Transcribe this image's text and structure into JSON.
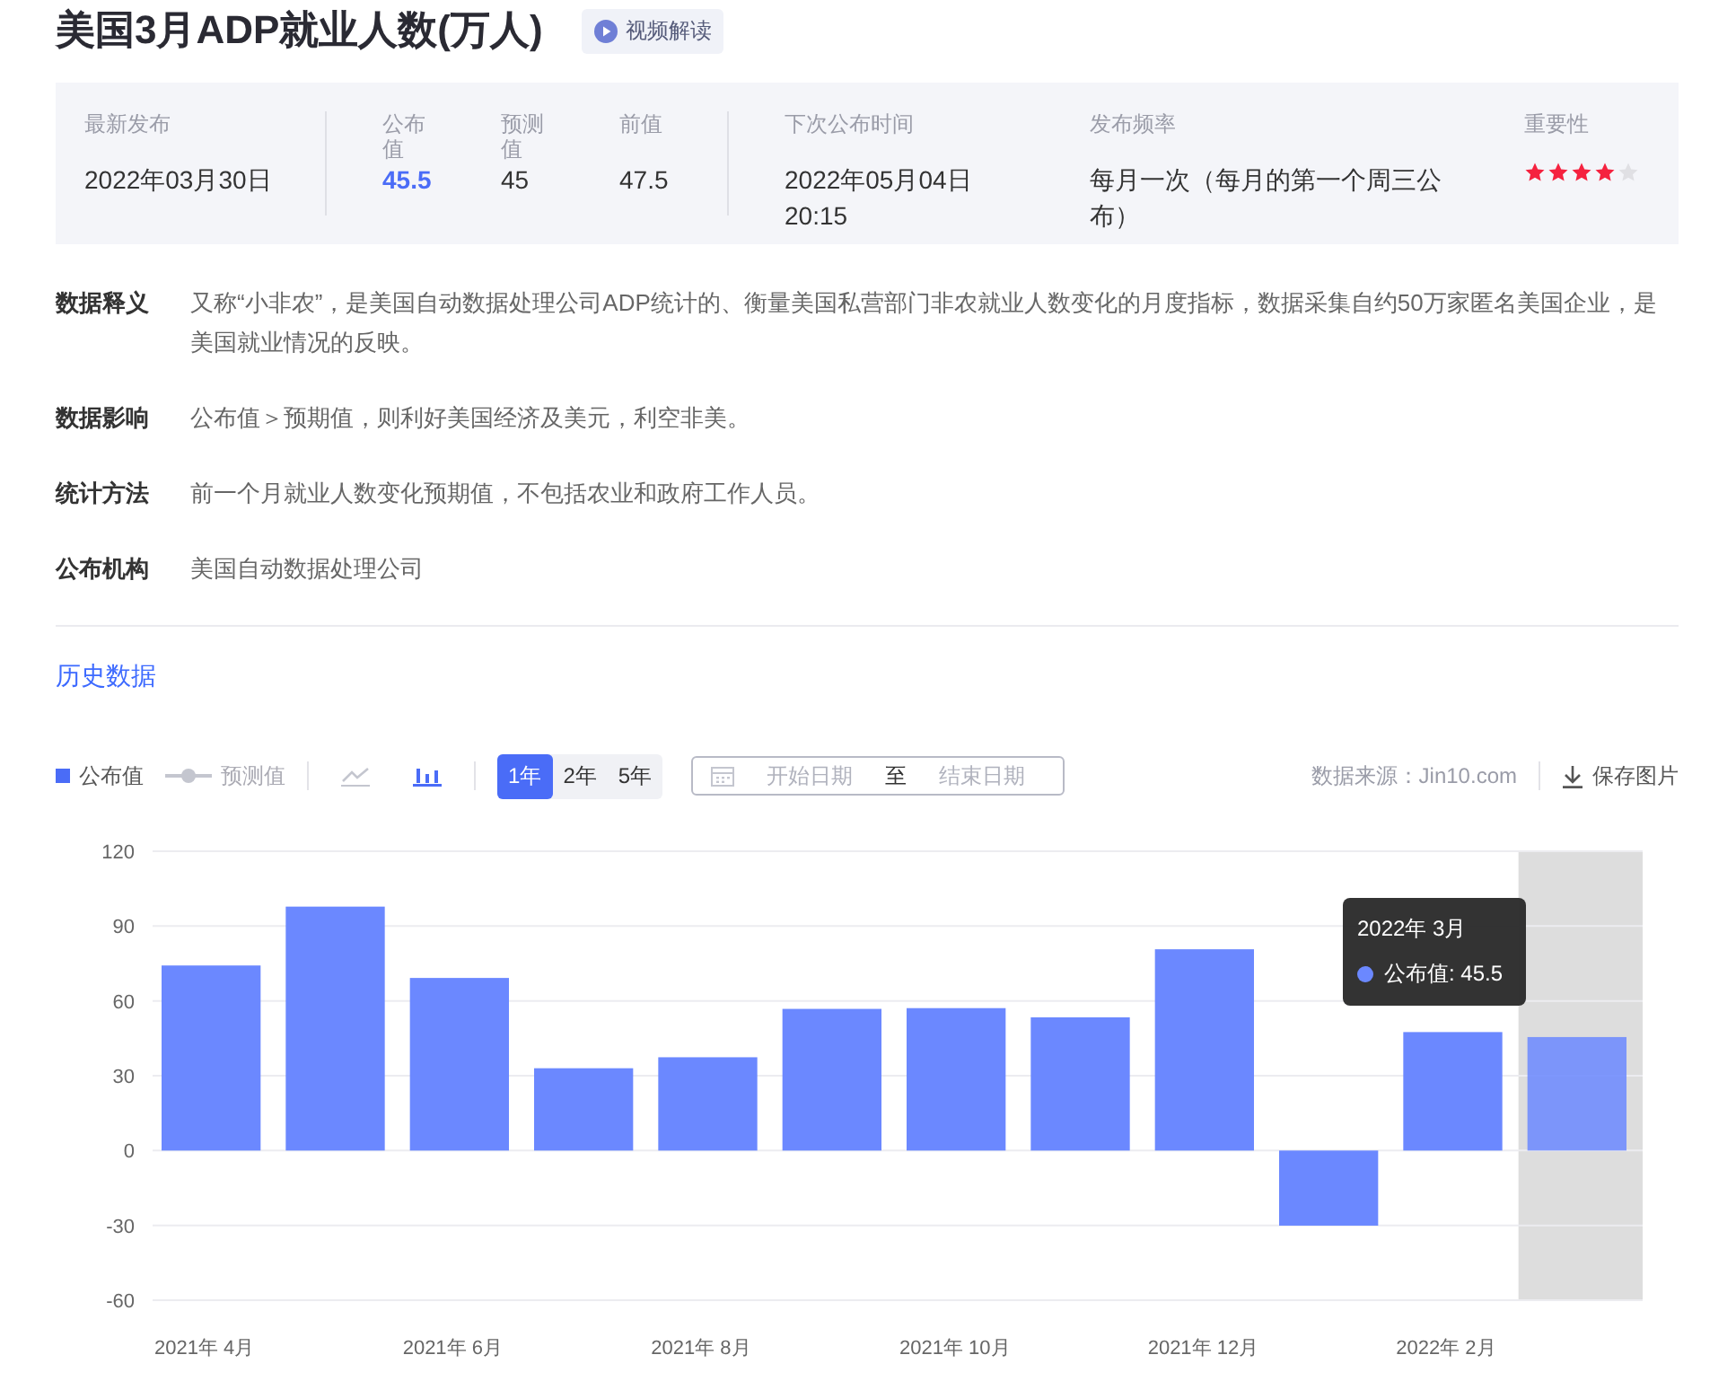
{
  "title": "美国3月ADP就业人数(万人)",
  "video_button": "视频解读",
  "summary": {
    "latest": {
      "label": "最新发布",
      "value": "2022年03月30日"
    },
    "actual": {
      "label": "公布值",
      "value": "45.5"
    },
    "forecast": {
      "label": "预测值",
      "value": "45"
    },
    "previous": {
      "label": "前值",
      "value": "47.5"
    },
    "next": {
      "label": "下次公布时间",
      "value": "2022年05月04日 20:15"
    },
    "frequency": {
      "label": "发布频率",
      "value": "每月一次（每月的第一个周三公布）"
    },
    "importance": {
      "label": "重要性",
      "stars": 4
    }
  },
  "details": [
    {
      "label": "数据释义",
      "text": "又称“小非农”，是美国自动数据处理公司ADP统计的、衡量美国私营部门非农就业人数变化的月度指标，数据采集自约50万家匿名美国企业，是美国就业情况的反映。"
    },
    {
      "label": "数据影响",
      "text": "公布值＞预期值，则利好美国经济及美元，利空非美。"
    },
    {
      "label": "统计方法",
      "text": "前一个月就业人数变化预期值，不包括农业和政府工作人员。"
    },
    {
      "label": "公布机构",
      "text": "美国自动数据处理公司"
    }
  ],
  "history_title": "历史数据",
  "toolbar": {
    "legend": [
      {
        "label": "公布值",
        "kind": "bar",
        "on": true
      },
      {
        "label": "预测值",
        "kind": "line",
        "on": false
      }
    ],
    "chart_types": [
      {
        "kind": "line",
        "selected": false
      },
      {
        "kind": "bar",
        "selected": true
      }
    ],
    "ranges": [
      {
        "label": "1年",
        "selected": true
      },
      {
        "label": "2年",
        "selected": false
      },
      {
        "label": "5年",
        "selected": false
      }
    ],
    "date_range": {
      "start_placeholder": "开始日期",
      "separator": "至",
      "end_placeholder": "结束日期"
    },
    "source": "数据来源：Jin10.com",
    "save": "保存图片"
  },
  "chart": {
    "tooltip": {
      "title": "2022年 3月",
      "separator": ":",
      "value": "45.5"
    },
    "chart_data": {
      "type": "bar",
      "grid": true,
      "categories": [
        "2021年 4月",
        null,
        "2021年 6月",
        null,
        "2021年 8月",
        null,
        "2021年 10月",
        null,
        "2021年 12月",
        null,
        "2022年 2月",
        null
      ],
      "series": [
        {
          "name": "公布值",
          "color": "#6b88ff",
          "values": [
            74.2,
            97.8,
            69.2,
            33,
            37.4,
            56.8,
            57.1,
            53.4,
            80.7,
            -30.1,
            47.5,
            45.5
          ]
        }
      ],
      "ylim": [
        -60,
        120
      ],
      "yticks": [
        -60,
        -30,
        0,
        30,
        60,
        90,
        120
      ]
    }
  }
}
